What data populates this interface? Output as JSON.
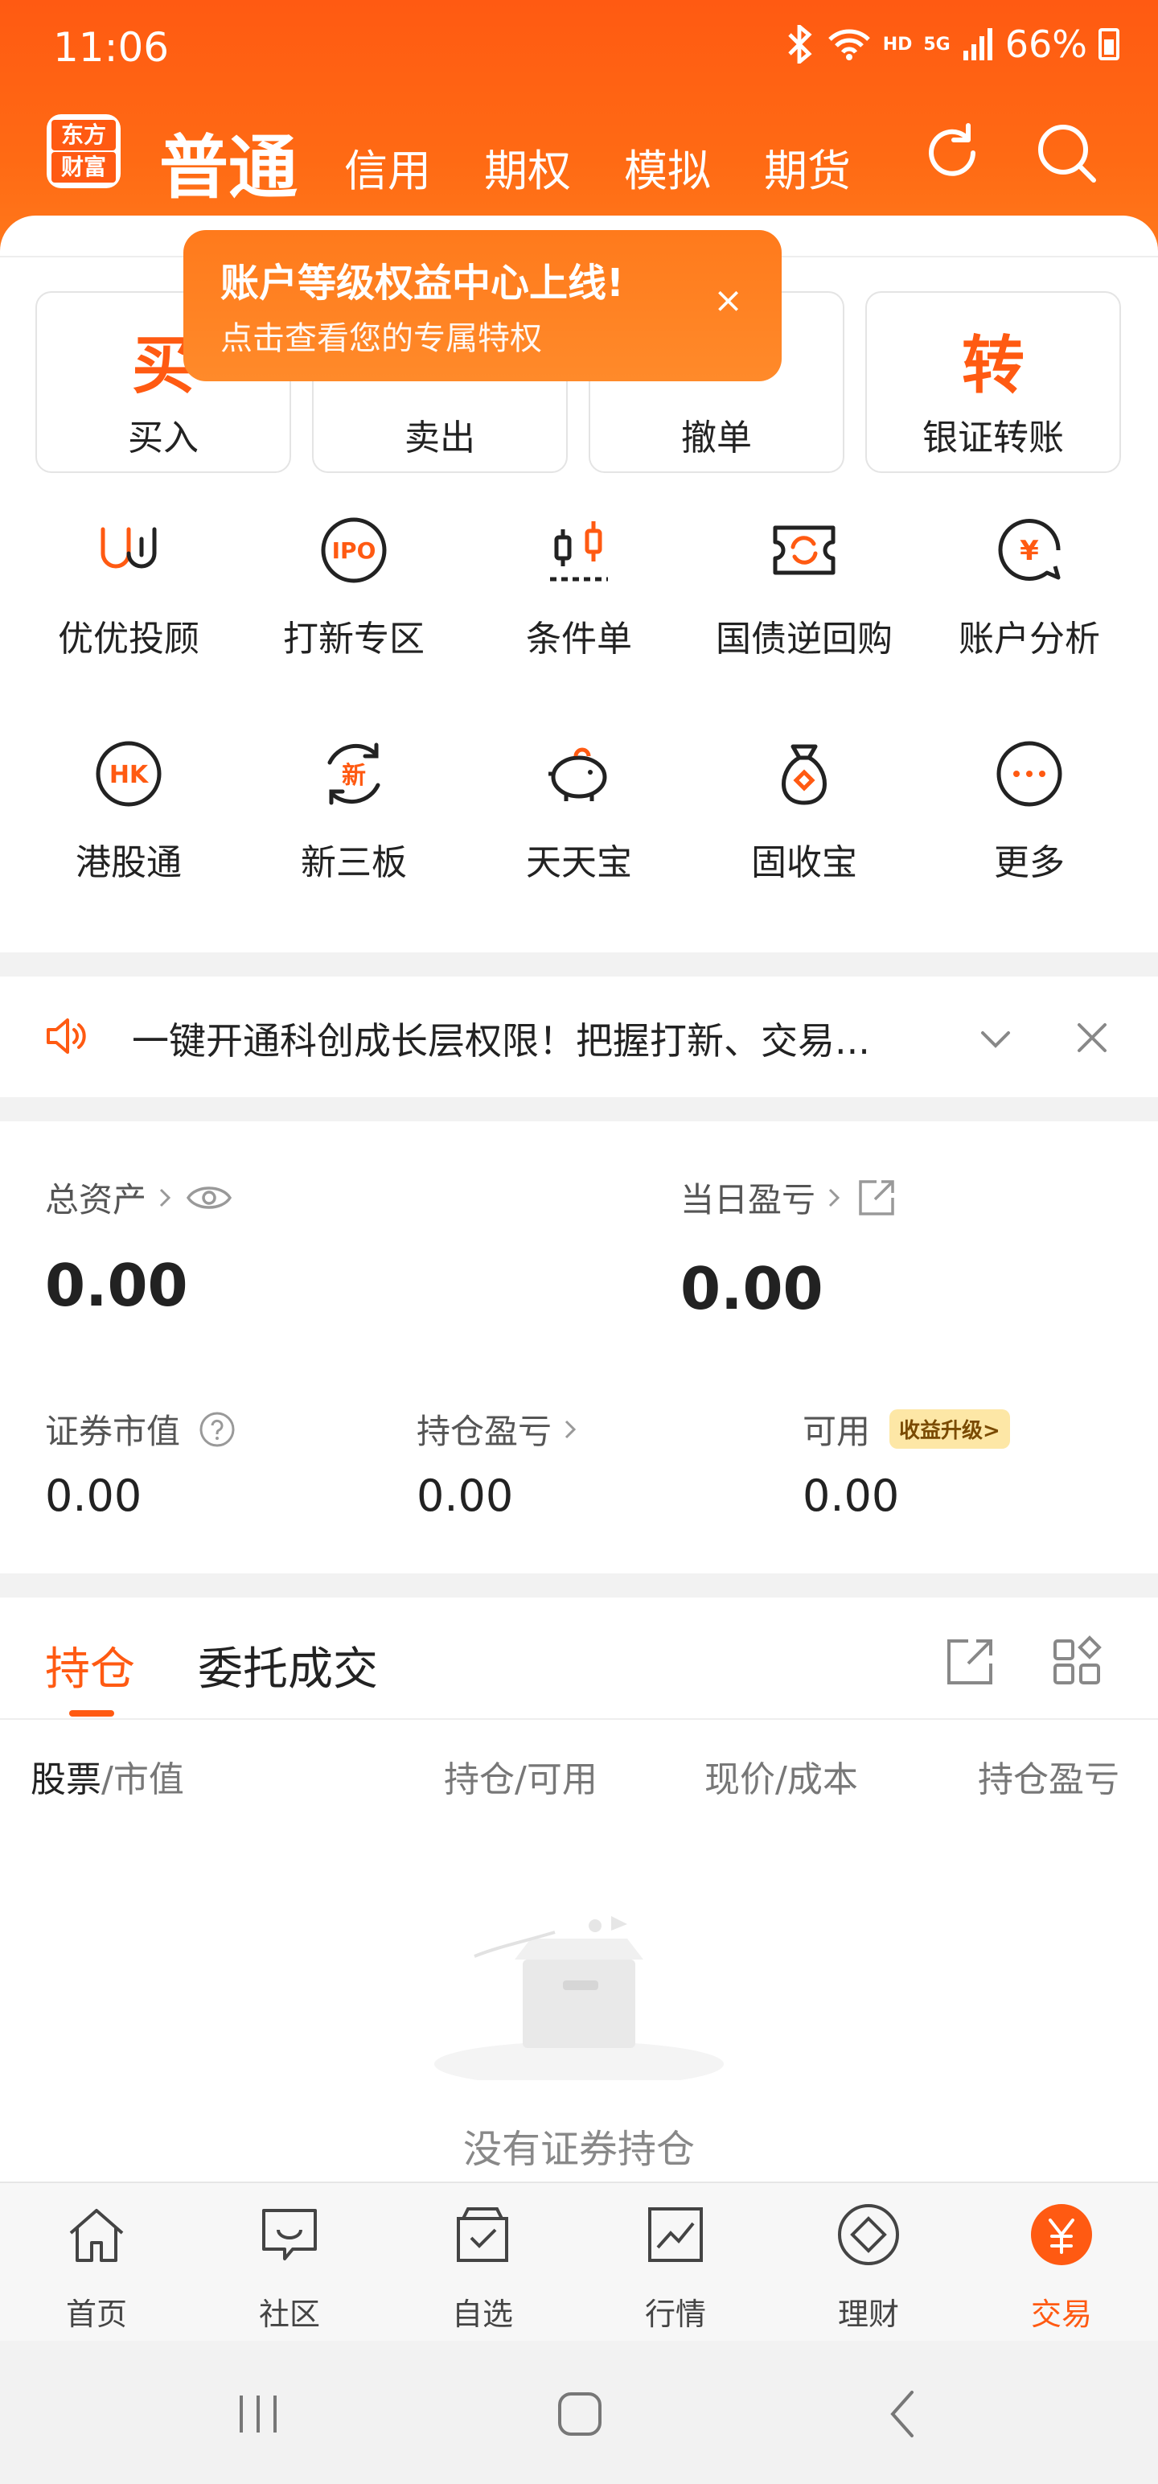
{
  "status_bar": {
    "time": "11:06",
    "network": "HD",
    "signal": "5G",
    "battery": "66%"
  },
  "header": {
    "logo_line1": "东方",
    "logo_line2": "财富",
    "tabs": [
      "普通",
      "信用",
      "期权",
      "模拟",
      "期货"
    ]
  },
  "actions": [
    {
      "big": "买",
      "label": "买入"
    },
    {
      "big": "",
      "label": "卖出"
    },
    {
      "big": "",
      "label": "撤单"
    },
    {
      "big": "转",
      "label": "银证转账"
    }
  ],
  "tooltip": {
    "title": "账户等级权益中心上线!",
    "subtitle": "点击查看您的专属特权",
    "close": "×"
  },
  "grid": [
    {
      "label": "优优投顾",
      "icon": "youyou-icon"
    },
    {
      "label": "打新专区",
      "icon": "ipo-icon"
    },
    {
      "label": "条件单",
      "icon": "candlestick-icon"
    },
    {
      "label": "国债逆回购",
      "icon": "repo-icon"
    },
    {
      "label": "账户分析",
      "icon": "yuan-chat-icon"
    },
    {
      "label": "港股通",
      "icon": "hk-icon"
    },
    {
      "label": "新三板",
      "icon": "xin-icon"
    },
    {
      "label": "天天宝",
      "icon": "piggy-icon"
    },
    {
      "label": "固收宝",
      "icon": "money-bag-icon"
    },
    {
      "label": "更多",
      "icon": "more-icon"
    }
  ],
  "banner": {
    "text": "一键开通科创成长层权限！把握打新、交易..."
  },
  "assets": {
    "total_label": "总资产",
    "total_value": "0.00",
    "daily_label": "当日盈亏",
    "daily_value": "0.00",
    "market_label": "证券市值",
    "market_value": "0.00",
    "position_pl_label": "持仓盈亏",
    "position_pl_value": "0.00",
    "available_label": "可用",
    "available_value": "0.00",
    "badge": "收益升级>"
  },
  "positions": {
    "tabs": [
      "持仓",
      "委托成交"
    ],
    "col_stock": "股票",
    "col_stock_sub": "/市值",
    "col_hold": "持仓/可用",
    "col_price": "现价/成本",
    "col_pl": "持仓盈亏",
    "empty_text": "没有证券持仓"
  },
  "bottom_nav": [
    {
      "label": "首页",
      "icon": "home-icon"
    },
    {
      "label": "社区",
      "icon": "chat-icon"
    },
    {
      "label": "自选",
      "icon": "watchlist-icon"
    },
    {
      "label": "行情",
      "icon": "market-chart-icon"
    },
    {
      "label": "理财",
      "icon": "diamond-icon"
    },
    {
      "label": "交易",
      "icon": "yuan-trade-icon",
      "active": true
    }
  ],
  "colors": {
    "accent": "#ff5a12",
    "badge_bg": "#fde7a6"
  }
}
